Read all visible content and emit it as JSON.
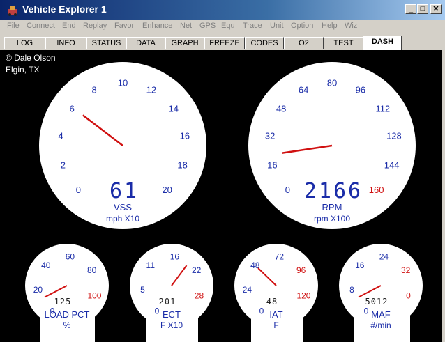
{
  "window": {
    "title": "Vehicle Explorer 1",
    "minimize": "_",
    "maximize": "□",
    "close": "✕"
  },
  "menu": [
    "File",
    "Connect",
    "End",
    "Replay",
    "Favor",
    "Enhance",
    "Net",
    "GPS",
    "Equ",
    "Trace",
    "Unit",
    "Option",
    "Help",
    "Wiz"
  ],
  "tabs": [
    "LOG",
    "INFO",
    "STATUS",
    "DATA",
    "GRAPH",
    "FREEZE",
    "CODES",
    "O2",
    "TEST",
    "DASH"
  ],
  "active_tab": "DASH",
  "credit": {
    "author": "© Dale Olson",
    "location": "Elgin, TX"
  },
  "colors": {
    "tick_blue": "#1a2ca8",
    "tick_red": "#d01010",
    "needle": "#d01010",
    "face": "#ffffff",
    "background": "#000000"
  },
  "gauges": [
    {
      "id": "vss",
      "label": "VSS",
      "unit": "mph X10",
      "readout": "61",
      "ticks": [
        "0",
        "2",
        "4",
        "6",
        "8",
        "10",
        "12",
        "14",
        "16",
        "18",
        "20"
      ],
      "red_ticks": [],
      "needle_value": 6.1
    },
    {
      "id": "rpm",
      "label": "RPM",
      "unit": "rpm X100",
      "readout": "2166",
      "ticks": [
        "0",
        "16",
        "32",
        "48",
        "64",
        "80",
        "96",
        "112",
        "128",
        "144",
        "160"
      ],
      "red_ticks": [
        "160"
      ],
      "needle_value": 21.66
    },
    {
      "id": "load",
      "label": "LOAD  PCT",
      "unit": "%",
      "readout": "125",
      "ticks": [
        "0",
        "20",
        "40",
        "60",
        "80",
        "100"
      ],
      "red_ticks": [
        "100"
      ],
      "needle_value": 12.5
    },
    {
      "id": "ect",
      "label": "ECT",
      "unit": "F X10",
      "readout": "201",
      "ticks": [
        "0",
        "5",
        "11",
        "16",
        "22",
        "28"
      ],
      "red_ticks": [
        "28"
      ],
      "needle_value": 20.1
    },
    {
      "id": "iat",
      "label": "IAT",
      "unit": "F",
      "readout": "48",
      "ticks": [
        "0",
        "24",
        "48",
        "72",
        "96",
        "120"
      ],
      "red_ticks": [
        "96",
        "120"
      ],
      "needle_value": 48
    },
    {
      "id": "maf",
      "label": "MAF",
      "unit": "#/min",
      "readout": "5012",
      "ticks": [
        "0",
        "8",
        "16",
        "24",
        "32",
        "0"
      ],
      "red_ticks": [
        "32",
        "0"
      ],
      "needle_value": 5
    }
  ]
}
